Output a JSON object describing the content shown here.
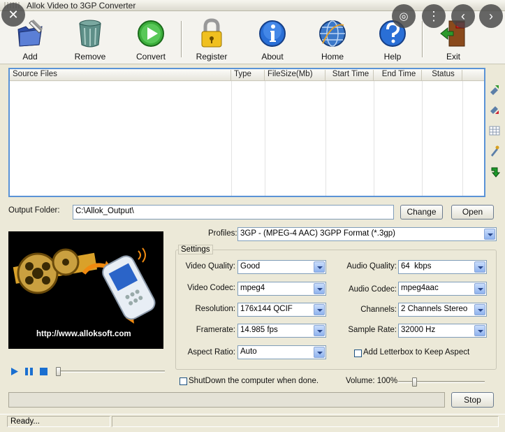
{
  "window": {
    "title": "Allok Video to 3GP Converter"
  },
  "toolbar": {
    "add": "Add",
    "remove": "Remove",
    "convert": "Convert",
    "register": "Register",
    "about": "About",
    "home": "Home",
    "help": "Help",
    "exit": "Exit"
  },
  "table": {
    "columns": [
      "Source Files",
      "Type",
      "FileSize(Mb)",
      "Start Time",
      "End Time",
      "Status"
    ]
  },
  "output": {
    "label": "Output Folder:",
    "path": "C:\\Allok_Output\\",
    "change": "Change",
    "open": "Open"
  },
  "preview": {
    "url": "http://www.alloksoft.com"
  },
  "profiles": {
    "label": "Profiles:",
    "value": "3GP - (MPEG-4 AAC) 3GPP Format (*.3gp)"
  },
  "settings": {
    "legend": "Settings",
    "video_quality_label": "Video Quality:",
    "video_quality": "Good",
    "video_codec_label": "Video Codec:",
    "video_codec": "mpeg4",
    "resolution_label": "Resolution:",
    "resolution": "176x144 QCIF",
    "framerate_label": "Framerate:",
    "framerate": "14.985 fps",
    "aspect_ratio_label": "Aspect Ratio:",
    "aspect_ratio": "Auto",
    "audio_quality_label": "Audio Quality:",
    "audio_quality": "64  kbps",
    "audio_codec_label": "Audio Codec:",
    "audio_codec": "mpeg4aac",
    "channels_label": "Channels:",
    "channels": "2 Channels Stereo",
    "sample_rate_label": "Sample Rate:",
    "sample_rate": "32000 Hz",
    "letterbox_label": "Add Letterbox to Keep Aspect"
  },
  "options": {
    "shutdown_label": "ShutDown the computer when done."
  },
  "volume": {
    "label": "Volume: 100%",
    "level": 1.0
  },
  "actions": {
    "stop": "Stop"
  },
  "statusbar": {
    "text": "Ready..."
  },
  "colors": {
    "table_border": "#5a93d6",
    "window_bg": "#ece9d8",
    "accent_blue": "#1a6fd0"
  }
}
